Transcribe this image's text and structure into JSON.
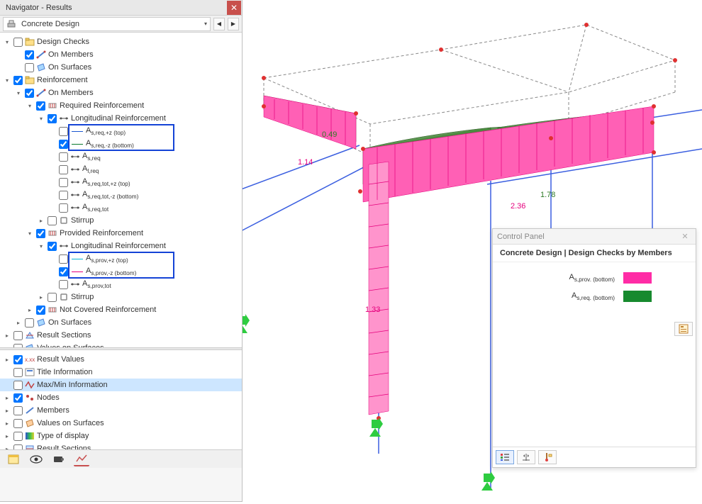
{
  "navigator": {
    "title": "Navigator - Results",
    "dropdown": "Concrete Design",
    "tree": [
      {
        "indent": 0,
        "exp": "open",
        "chk": false,
        "icon": "folder",
        "label": "Design Checks"
      },
      {
        "indent": 1,
        "exp": "none",
        "chk": true,
        "icon": "member",
        "label": "On Members"
      },
      {
        "indent": 1,
        "exp": "none",
        "chk": false,
        "icon": "surface",
        "label": "On Surfaces"
      },
      {
        "indent": 0,
        "exp": "open",
        "chk": true,
        "icon": "folder",
        "label": "Reinforcement"
      },
      {
        "indent": 1,
        "exp": "open",
        "chk": true,
        "icon": "member",
        "label": "On Members"
      },
      {
        "indent": 2,
        "exp": "open",
        "chk": true,
        "icon": "req",
        "label": "Required Reinforcement"
      },
      {
        "indent": 3,
        "exp": "open",
        "chk": true,
        "icon": "long",
        "label": "Longitudinal Reinforcement"
      },
      {
        "indent": 4,
        "exp": "none",
        "chk": false,
        "color": "#1b57d1",
        "html": "A<sub>s,req,+z (top)</sub>",
        "frame": "f1t"
      },
      {
        "indent": 4,
        "exp": "none",
        "chk": true,
        "color": "#0a7a2f",
        "html": "A<sub>s,req,-z (bottom)</sub>",
        "frame": "f1b"
      },
      {
        "indent": 4,
        "exp": "none",
        "chk": false,
        "icon": "long",
        "html": "A<sub>s,req</sub>"
      },
      {
        "indent": 4,
        "exp": "none",
        "chk": false,
        "icon": "long",
        "html": "A<sub>l,req</sub>"
      },
      {
        "indent": 4,
        "exp": "none",
        "chk": false,
        "icon": "long",
        "html": "A<sub>s,req,tot,+z (top)</sub>"
      },
      {
        "indent": 4,
        "exp": "none",
        "chk": false,
        "icon": "long",
        "html": "A<sub>s,req,tot,-z (bottom)</sub>"
      },
      {
        "indent": 4,
        "exp": "none",
        "chk": false,
        "icon": "long",
        "html": "A<sub>s,req,tot</sub>"
      },
      {
        "indent": 3,
        "exp": "closed",
        "chk": false,
        "icon": "stirrup",
        "label": "Stirrup"
      },
      {
        "indent": 2,
        "exp": "open",
        "chk": true,
        "icon": "prov",
        "label": "Provided Reinforcement"
      },
      {
        "indent": 3,
        "exp": "open",
        "chk": true,
        "icon": "long",
        "label": "Longitudinal Reinforcement"
      },
      {
        "indent": 4,
        "exp": "none",
        "chk": false,
        "color": "#06b5d4",
        "html": "A<sub>s,prov,+z (top)</sub>",
        "frame": "f2t"
      },
      {
        "indent": 4,
        "exp": "none",
        "chk": true,
        "color": "#e5007d",
        "html": "A<sub>s,prov,-z (bottom)</sub>",
        "frame": "f2b"
      },
      {
        "indent": 4,
        "exp": "none",
        "chk": false,
        "icon": "long",
        "html": "A<sub>s,prov,tot</sub>"
      },
      {
        "indent": 3,
        "exp": "closed",
        "chk": false,
        "icon": "stirrup",
        "label": "Stirrup"
      },
      {
        "indent": 2,
        "exp": "closed",
        "chk": true,
        "icon": "notcov",
        "label": "Not Covered Reinforcement"
      },
      {
        "indent": 1,
        "exp": "closed",
        "chk": false,
        "icon": "surface",
        "label": "On Surfaces"
      },
      {
        "indent": 0,
        "exp": "closed",
        "chk": false,
        "icon": "section",
        "label": "Result Sections"
      },
      {
        "indent": 0,
        "exp": "none",
        "chk": false,
        "icon": "surface",
        "label": "Values on Surfaces"
      }
    ],
    "tree2": [
      {
        "indent": 0,
        "exp": "closed",
        "chk": true,
        "icon": "rv",
        "label": "Result Values"
      },
      {
        "indent": 0,
        "exp": "none",
        "chk": false,
        "icon": "title",
        "label": "Title Information"
      },
      {
        "indent": 0,
        "exp": "none",
        "chk": false,
        "icon": "maxmin",
        "label": "Max/Min Information",
        "selected": true
      },
      {
        "indent": 0,
        "exp": "closed",
        "chk": true,
        "icon": "nodes",
        "label": "Nodes"
      },
      {
        "indent": 0,
        "exp": "closed",
        "chk": false,
        "icon": "members",
        "label": "Members"
      },
      {
        "indent": 0,
        "exp": "closed",
        "chk": false,
        "icon": "vos",
        "label": "Values on Surfaces"
      },
      {
        "indent": 0,
        "exp": "closed",
        "chk": false,
        "icon": "display",
        "label": "Type of display"
      },
      {
        "indent": 0,
        "exp": "closed",
        "chk": false,
        "icon": "rsec",
        "label": "Result Sections"
      }
    ]
  },
  "viewport": {
    "annotations": {
      "v049": "0.49",
      "v114": "1.14",
      "v178": "1.78",
      "v236": "2.36",
      "v133": "1.33"
    }
  },
  "control_panel": {
    "title": "Control Panel",
    "heading": "Concrete Design | Design Checks by Members",
    "legend": [
      {
        "html": "A<sub>s,prov. (bottom)</sub>",
        "color": "#ff2ca6"
      },
      {
        "html": "A<sub>s,req. (bottom)</sub>",
        "color": "#178a2e"
      }
    ]
  }
}
